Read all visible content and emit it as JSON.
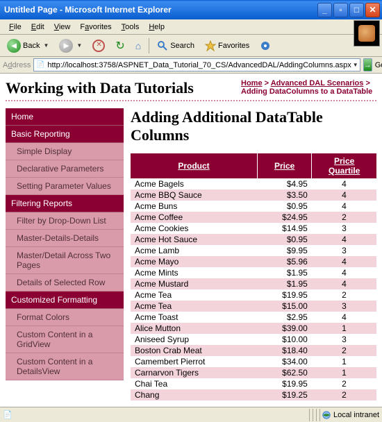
{
  "titlebar": "Untitled Page - Microsoft Internet Explorer",
  "menu": {
    "file": "File",
    "edit": "Edit",
    "view": "View",
    "favorites": "Favorites",
    "tools": "Tools",
    "help": "Help"
  },
  "toolbar": {
    "back": "Back",
    "search": "Search",
    "favorites": "Favorites"
  },
  "address": {
    "label": "Address",
    "url": "http://localhost:3758/ASPNET_Data_Tutorial_70_CS/AdvancedDAL/AddingColumns.aspx",
    "go": "Go"
  },
  "site_title": "Working with Data Tutorials",
  "breadcrumb": {
    "home": "Home",
    "sep": " > ",
    "l1": "Advanced DAL Scenarios",
    "tail": "Adding DataColumns to a DataTable"
  },
  "sidebar": [
    {
      "t": "h",
      "label": "Home"
    },
    {
      "t": "h",
      "label": "Basic Reporting"
    },
    {
      "t": "s",
      "label": "Simple Display"
    },
    {
      "t": "s",
      "label": "Declarative Parameters"
    },
    {
      "t": "s",
      "label": "Setting Parameter Values"
    },
    {
      "t": "h",
      "label": "Filtering Reports"
    },
    {
      "t": "s",
      "label": "Filter by Drop-Down List"
    },
    {
      "t": "s",
      "label": "Master-Details-Details"
    },
    {
      "t": "s",
      "label": "Master/Detail Across Two Pages"
    },
    {
      "t": "s",
      "label": "Details of Selected Row"
    },
    {
      "t": "h",
      "label": "Customized Formatting"
    },
    {
      "t": "s",
      "label": "Format Colors"
    },
    {
      "t": "s",
      "label": "Custom Content in a GridView"
    },
    {
      "t": "s",
      "label": "Custom Content in a DetailsView"
    }
  ],
  "heading": "Adding Additional DataTable Columns",
  "table": {
    "headers": [
      "Product",
      "Price",
      "Price Quartile"
    ],
    "rows": [
      [
        "Acme Bagels",
        "$4.95",
        "4"
      ],
      [
        "Acme BBQ Sauce",
        "$3.50",
        "4"
      ],
      [
        "Acme Buns",
        "$0.95",
        "4"
      ],
      [
        "Acme Coffee",
        "$24.95",
        "2"
      ],
      [
        "Acme Cookies",
        "$14.95",
        "3"
      ],
      [
        "Acme Hot Sauce",
        "$0.95",
        "4"
      ],
      [
        "Acme Lamb",
        "$9.95",
        "3"
      ],
      [
        "Acme Mayo",
        "$5.96",
        "4"
      ],
      [
        "Acme Mints",
        "$1.95",
        "4"
      ],
      [
        "Acme Mustard",
        "$1.95",
        "4"
      ],
      [
        "Acme Tea",
        "$19.95",
        "2"
      ],
      [
        "Acme Tea",
        "$15.00",
        "3"
      ],
      [
        "Acme Toast",
        "$2.95",
        "4"
      ],
      [
        "Alice Mutton",
        "$39.00",
        "1"
      ],
      [
        "Aniseed Syrup",
        "$10.00",
        "3"
      ],
      [
        "Boston Crab Meat",
        "$18.40",
        "2"
      ],
      [
        "Camembert Pierrot",
        "$34.00",
        "1"
      ],
      [
        "Carnarvon Tigers",
        "$62.50",
        "1"
      ],
      [
        "Chai Tea",
        "$19.95",
        "2"
      ],
      [
        "Chang",
        "$19.25",
        "2"
      ]
    ]
  },
  "status": {
    "zone": "Local intranet"
  }
}
